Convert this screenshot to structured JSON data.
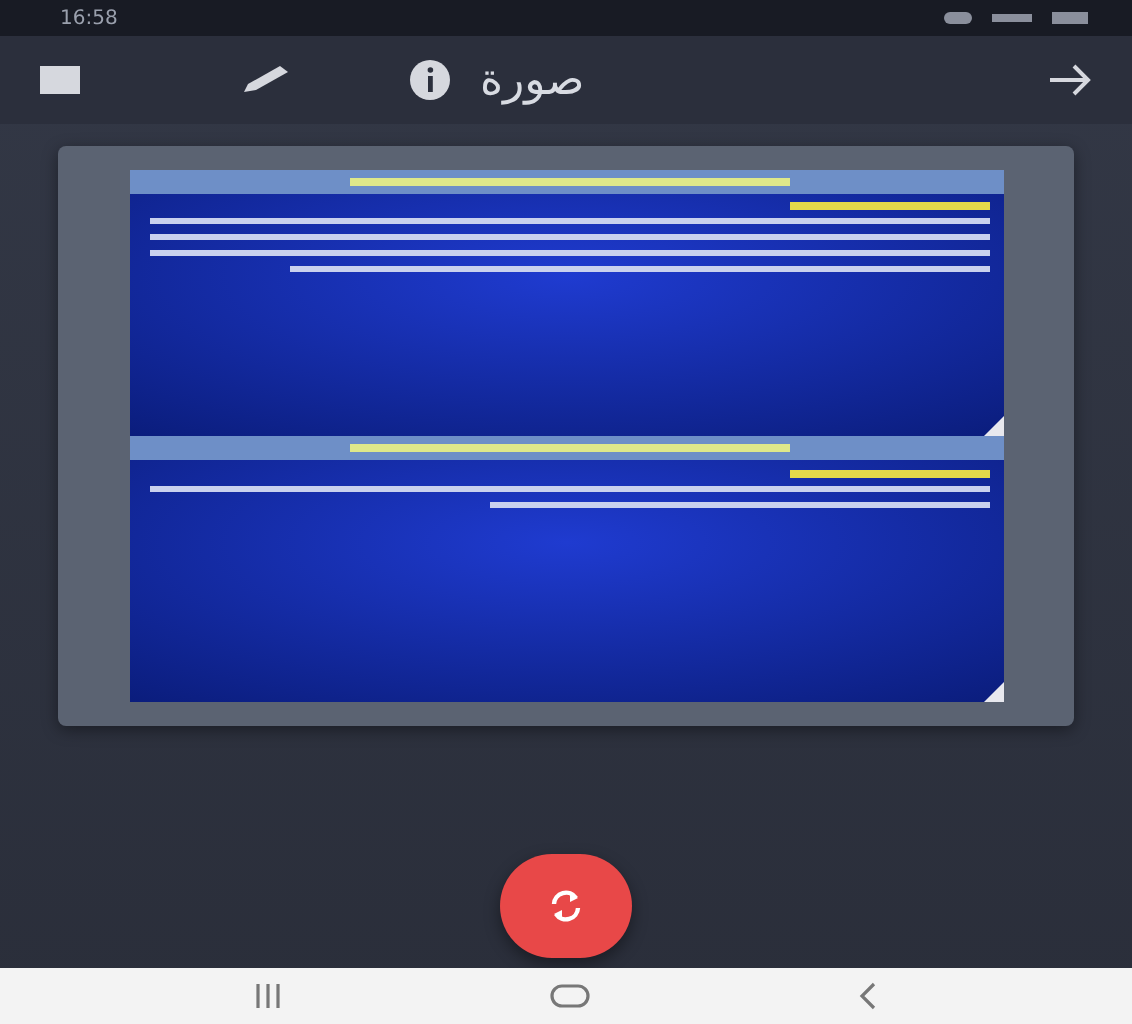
{
  "status_bar": {
    "time": "16:58"
  },
  "toolbar": {
    "title": "صورة"
  }
}
